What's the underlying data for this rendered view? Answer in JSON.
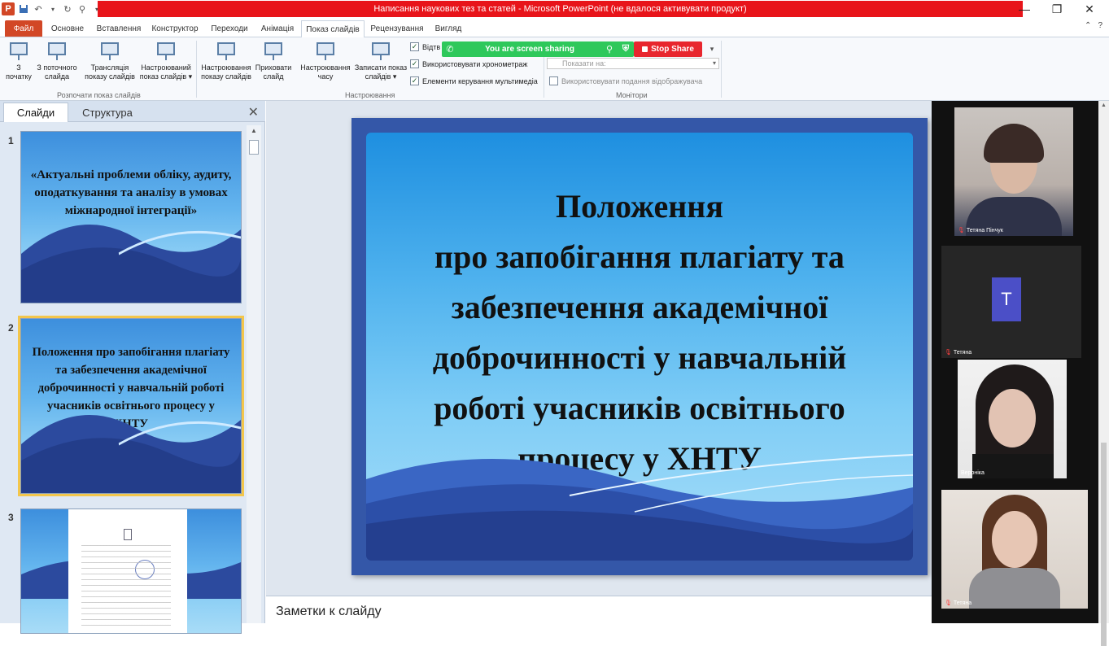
{
  "window": {
    "title": "Написання наукових тез та статей  -  Microsoft PowerPoint (не вдалося активувати продукт)",
    "app_logo": "P",
    "controls": {
      "minimize": "—",
      "restore": "❐",
      "close": "✕"
    }
  },
  "ribbon_tabs": [
    {
      "label": "Файл"
    },
    {
      "label": "Основне"
    },
    {
      "label": "Вставлення"
    },
    {
      "label": "Конструктор"
    },
    {
      "label": "Переходи"
    },
    {
      "label": "Анімація"
    },
    {
      "label": "Показ слайдів",
      "active": true
    },
    {
      "label": "Рецензування"
    },
    {
      "label": "Вигляд"
    }
  ],
  "ribbon": {
    "buttons": [
      {
        "label": "З\nпочатку",
        "icon": "slideshow-start-icon"
      },
      {
        "label": "З поточного\nслайда",
        "icon": "slideshow-current-icon"
      },
      {
        "label": "Трансляція\nпоказу слайдів",
        "icon": "broadcast-icon"
      },
      {
        "label": "Настроюваний\nпоказ слайдів ▾",
        "icon": "custom-show-icon"
      },
      {
        "label": "Настроювання\nпоказу слайдів",
        "icon": "setup-show-icon"
      },
      {
        "label": "Приховати\nслайд",
        "icon": "hide-slide-icon"
      },
      {
        "label": "Настроювання\nчасу",
        "icon": "rehearse-timings-icon"
      },
      {
        "label": "Записати показ\nслайдів ▾",
        "icon": "record-show-icon"
      }
    ],
    "groups": {
      "start": "Розпочати показ слайдів",
      "setup": "Настроювання",
      "monitors": "Монітори"
    },
    "checkboxes": [
      {
        "label": "Відтв",
        "checked": true
      },
      {
        "label": "Використовувати хронометраж",
        "checked": true
      },
      {
        "label": "Елементи керування мультимедіа",
        "checked": true
      }
    ],
    "monitor_dropdown": {
      "label": "Показати на:"
    },
    "presenter_view": {
      "label": "Використовувати подання відображувача",
      "checked": false
    }
  },
  "zoom_share": {
    "sharing_text": "You are screen sharing",
    "stop_label": "Stop Share",
    "more": "▾"
  },
  "slides_pane": {
    "tabs": [
      "Слайди",
      "Структура"
    ],
    "close": "✕",
    "slides": [
      {
        "number": "1",
        "title": "«Актуальні проблеми обліку, аудиту, оподаткування та аналізу в умовах міжнародної інтеграції»"
      },
      {
        "number": "2",
        "title": "Положення про запобігання плагіату та забезпечення академічної доброчинності у навчальній роботі учасників освітнього процесу у ХНТУ",
        "selected": true
      },
      {
        "number": "3",
        "title": ""
      }
    ]
  },
  "current_slide": {
    "title_line1": "Положення",
    "title_rest": "про запобігання плагіату та забезпечення академічної доброчинності у навчальній роботі учасників освітнього процесу у ХНТУ"
  },
  "notes": {
    "placeholder": "Заметки к слайду"
  },
  "participants": [
    {
      "name": "Тетяна Пінчук",
      "muted": true
    },
    {
      "name": "Тетяна",
      "initial": "T",
      "muted": true
    },
    {
      "name": "Вероніка",
      "muted": false
    },
    {
      "name": "Тетяна",
      "muted": true
    }
  ],
  "colors": {
    "title_bar": "#e8141a",
    "share_green": "#2ec85b",
    "stop_red": "#e8262e",
    "file_tab": "#d24726"
  }
}
